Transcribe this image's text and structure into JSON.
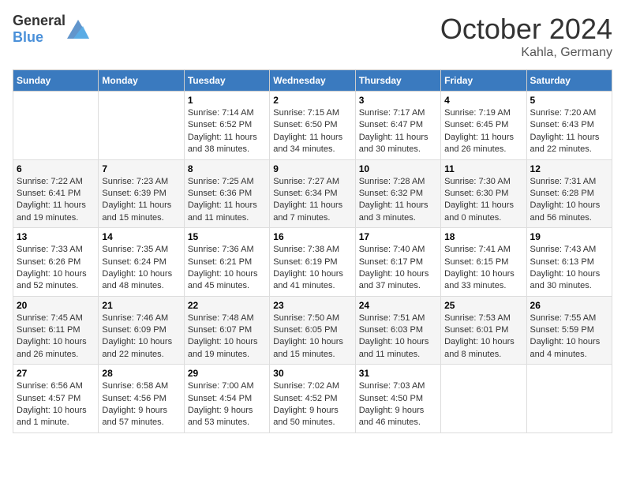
{
  "header": {
    "logo_general": "General",
    "logo_blue": "Blue",
    "month": "October 2024",
    "location": "Kahla, Germany"
  },
  "columns": [
    "Sunday",
    "Monday",
    "Tuesday",
    "Wednesday",
    "Thursday",
    "Friday",
    "Saturday"
  ],
  "weeks": [
    [
      {
        "day": "",
        "sunrise": "",
        "sunset": "",
        "daylight": ""
      },
      {
        "day": "",
        "sunrise": "",
        "sunset": "",
        "daylight": ""
      },
      {
        "day": "1",
        "sunrise": "Sunrise: 7:14 AM",
        "sunset": "Sunset: 6:52 PM",
        "daylight": "Daylight: 11 hours and 38 minutes."
      },
      {
        "day": "2",
        "sunrise": "Sunrise: 7:15 AM",
        "sunset": "Sunset: 6:50 PM",
        "daylight": "Daylight: 11 hours and 34 minutes."
      },
      {
        "day": "3",
        "sunrise": "Sunrise: 7:17 AM",
        "sunset": "Sunset: 6:47 PM",
        "daylight": "Daylight: 11 hours and 30 minutes."
      },
      {
        "day": "4",
        "sunrise": "Sunrise: 7:19 AM",
        "sunset": "Sunset: 6:45 PM",
        "daylight": "Daylight: 11 hours and 26 minutes."
      },
      {
        "day": "5",
        "sunrise": "Sunrise: 7:20 AM",
        "sunset": "Sunset: 6:43 PM",
        "daylight": "Daylight: 11 hours and 22 minutes."
      }
    ],
    [
      {
        "day": "6",
        "sunrise": "Sunrise: 7:22 AM",
        "sunset": "Sunset: 6:41 PM",
        "daylight": "Daylight: 11 hours and 19 minutes."
      },
      {
        "day": "7",
        "sunrise": "Sunrise: 7:23 AM",
        "sunset": "Sunset: 6:39 PM",
        "daylight": "Daylight: 11 hours and 15 minutes."
      },
      {
        "day": "8",
        "sunrise": "Sunrise: 7:25 AM",
        "sunset": "Sunset: 6:36 PM",
        "daylight": "Daylight: 11 hours and 11 minutes."
      },
      {
        "day": "9",
        "sunrise": "Sunrise: 7:27 AM",
        "sunset": "Sunset: 6:34 PM",
        "daylight": "Daylight: 11 hours and 7 minutes."
      },
      {
        "day": "10",
        "sunrise": "Sunrise: 7:28 AM",
        "sunset": "Sunset: 6:32 PM",
        "daylight": "Daylight: 11 hours and 3 minutes."
      },
      {
        "day": "11",
        "sunrise": "Sunrise: 7:30 AM",
        "sunset": "Sunset: 6:30 PM",
        "daylight": "Daylight: 11 hours and 0 minutes."
      },
      {
        "day": "12",
        "sunrise": "Sunrise: 7:31 AM",
        "sunset": "Sunset: 6:28 PM",
        "daylight": "Daylight: 10 hours and 56 minutes."
      }
    ],
    [
      {
        "day": "13",
        "sunrise": "Sunrise: 7:33 AM",
        "sunset": "Sunset: 6:26 PM",
        "daylight": "Daylight: 10 hours and 52 minutes."
      },
      {
        "day": "14",
        "sunrise": "Sunrise: 7:35 AM",
        "sunset": "Sunset: 6:24 PM",
        "daylight": "Daylight: 10 hours and 48 minutes."
      },
      {
        "day": "15",
        "sunrise": "Sunrise: 7:36 AM",
        "sunset": "Sunset: 6:21 PM",
        "daylight": "Daylight: 10 hours and 45 minutes."
      },
      {
        "day": "16",
        "sunrise": "Sunrise: 7:38 AM",
        "sunset": "Sunset: 6:19 PM",
        "daylight": "Daylight: 10 hours and 41 minutes."
      },
      {
        "day": "17",
        "sunrise": "Sunrise: 7:40 AM",
        "sunset": "Sunset: 6:17 PM",
        "daylight": "Daylight: 10 hours and 37 minutes."
      },
      {
        "day": "18",
        "sunrise": "Sunrise: 7:41 AM",
        "sunset": "Sunset: 6:15 PM",
        "daylight": "Daylight: 10 hours and 33 minutes."
      },
      {
        "day": "19",
        "sunrise": "Sunrise: 7:43 AM",
        "sunset": "Sunset: 6:13 PM",
        "daylight": "Daylight: 10 hours and 30 minutes."
      }
    ],
    [
      {
        "day": "20",
        "sunrise": "Sunrise: 7:45 AM",
        "sunset": "Sunset: 6:11 PM",
        "daylight": "Daylight: 10 hours and 26 minutes."
      },
      {
        "day": "21",
        "sunrise": "Sunrise: 7:46 AM",
        "sunset": "Sunset: 6:09 PM",
        "daylight": "Daylight: 10 hours and 22 minutes."
      },
      {
        "day": "22",
        "sunrise": "Sunrise: 7:48 AM",
        "sunset": "Sunset: 6:07 PM",
        "daylight": "Daylight: 10 hours and 19 minutes."
      },
      {
        "day": "23",
        "sunrise": "Sunrise: 7:50 AM",
        "sunset": "Sunset: 6:05 PM",
        "daylight": "Daylight: 10 hours and 15 minutes."
      },
      {
        "day": "24",
        "sunrise": "Sunrise: 7:51 AM",
        "sunset": "Sunset: 6:03 PM",
        "daylight": "Daylight: 10 hours and 11 minutes."
      },
      {
        "day": "25",
        "sunrise": "Sunrise: 7:53 AM",
        "sunset": "Sunset: 6:01 PM",
        "daylight": "Daylight: 10 hours and 8 minutes."
      },
      {
        "day": "26",
        "sunrise": "Sunrise: 7:55 AM",
        "sunset": "Sunset: 5:59 PM",
        "daylight": "Daylight: 10 hours and 4 minutes."
      }
    ],
    [
      {
        "day": "27",
        "sunrise": "Sunrise: 6:56 AM",
        "sunset": "Sunset: 4:57 PM",
        "daylight": "Daylight: 10 hours and 1 minute."
      },
      {
        "day": "28",
        "sunrise": "Sunrise: 6:58 AM",
        "sunset": "Sunset: 4:56 PM",
        "daylight": "Daylight: 9 hours and 57 minutes."
      },
      {
        "day": "29",
        "sunrise": "Sunrise: 7:00 AM",
        "sunset": "Sunset: 4:54 PM",
        "daylight": "Daylight: 9 hours and 53 minutes."
      },
      {
        "day": "30",
        "sunrise": "Sunrise: 7:02 AM",
        "sunset": "Sunset: 4:52 PM",
        "daylight": "Daylight: 9 hours and 50 minutes."
      },
      {
        "day": "31",
        "sunrise": "Sunrise: 7:03 AM",
        "sunset": "Sunset: 4:50 PM",
        "daylight": "Daylight: 9 hours and 46 minutes."
      },
      {
        "day": "",
        "sunrise": "",
        "sunset": "",
        "daylight": ""
      },
      {
        "day": "",
        "sunrise": "",
        "sunset": "",
        "daylight": ""
      }
    ]
  ]
}
